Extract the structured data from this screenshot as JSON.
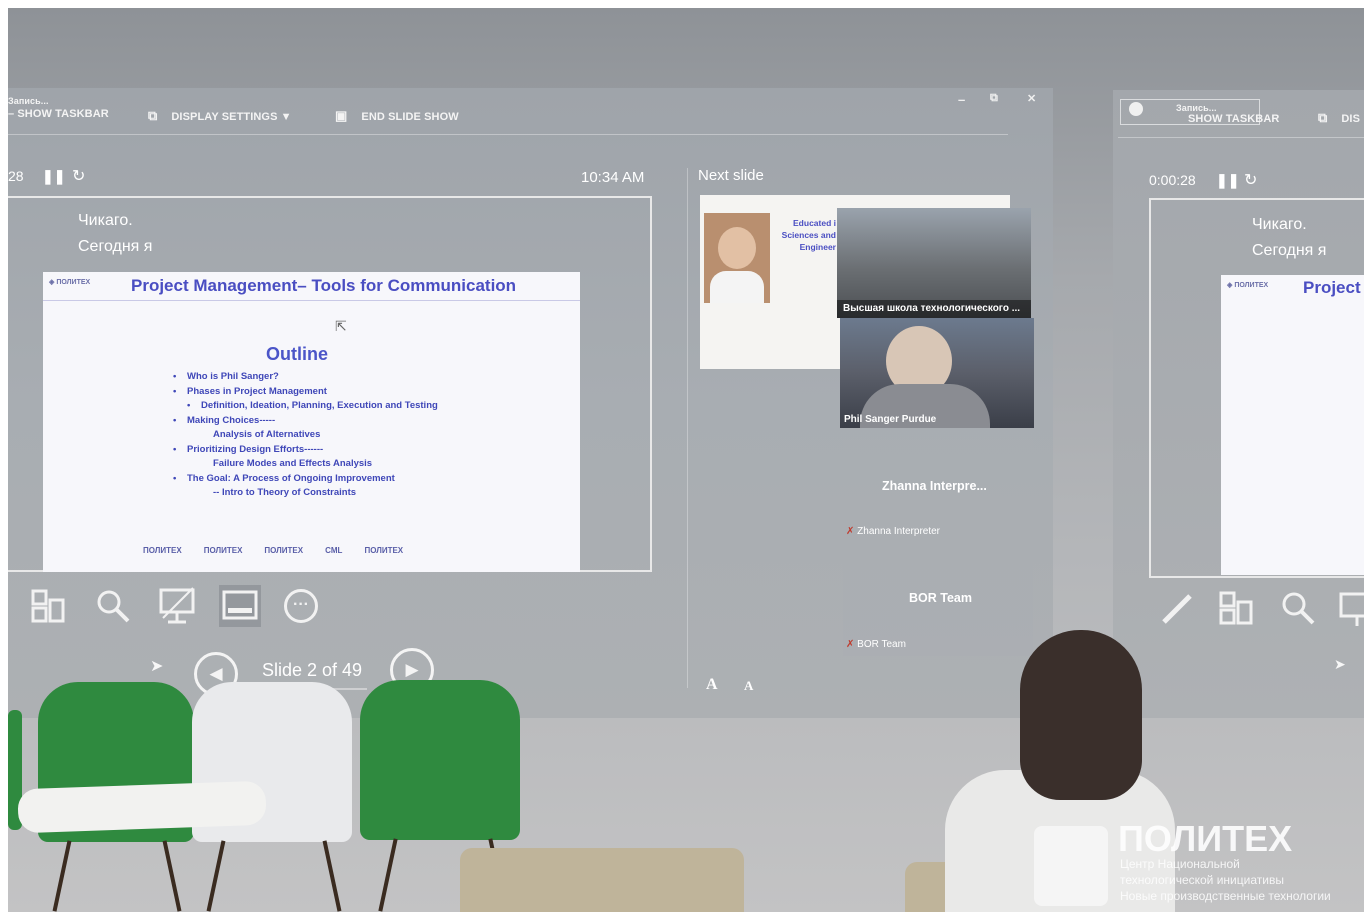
{
  "presenter": {
    "toolbar": {
      "recording_label": "Запись...",
      "show_taskbar": "SHOW TASKBAR",
      "display_settings": "DISPLAY SETTINGS ▼",
      "end_slide_show": "END SLIDE SHOW",
      "minimize": "–",
      "restore": "⧉",
      "close": "✕"
    },
    "timer": "28",
    "clock": "10:34 AM",
    "notes": [
      "Чикаго.",
      "Сегодня я"
    ],
    "current_slide": {
      "title": "Project Management– Tools for Communication",
      "logo": "ПОЛИТЕХ",
      "outline_heading": "Outline",
      "items": [
        {
          "level": 1,
          "text": "Who is Phil Sanger?"
        },
        {
          "level": 1,
          "text": "Phases in Project Management"
        },
        {
          "level": 2,
          "text": "Definition, Ideation, Planning, Execution and Testing"
        },
        {
          "level": 1,
          "text": "Making Choices-----"
        },
        {
          "level": 3,
          "text": "Analysis of Alternatives"
        },
        {
          "level": 1,
          "text": "Prioritizing Design Efforts------"
        },
        {
          "level": 3,
          "text": "Failure Modes and Effects Analysis"
        },
        {
          "level": 1,
          "text": "The Goal: A Process of Ongoing Improvement"
        },
        {
          "level": 3,
          "text": "-- Intro to Theory of Constraints"
        }
      ],
      "footer_logos": [
        "ПОЛИТЕХ",
        "ПОЛИТЕХ",
        "ПОЛИТЕХ",
        "CML",
        "ПОЛИТЕХ"
      ]
    },
    "slide_counter": "Slide 2 of 49",
    "next_slide_label": "Next slide",
    "next_slide_text": [
      "Educated i",
      "Sciences and",
      "Engineer"
    ],
    "video": {
      "tile1_caption": "Высшая школа технологического ...",
      "tile2_caption": "Phil Sanger Purdue"
    },
    "participants": [
      {
        "display": "Zhanna  Interpre...",
        "tag": "Zhanna Interpreter"
      },
      {
        "display": "BOR Team",
        "tag": "BOR Team"
      }
    ],
    "font_buttons": [
      "A",
      "A"
    ]
  },
  "right_screen": {
    "recording_label": "Запись...",
    "show_taskbar": "SHOW TASKBAR",
    "display_settings": "DIS",
    "timer": "0:00:28",
    "notes": [
      "Чикаго.",
      "Сегодня я"
    ],
    "slide_title": "Project",
    "logo": "ПОЛИТЕХ"
  },
  "watermark": {
    "name": "ПОЛИТЕХ",
    "line1": "Центр Национальной",
    "line2": "технологической инициативы",
    "line3": "Новые производственные технологии"
  }
}
